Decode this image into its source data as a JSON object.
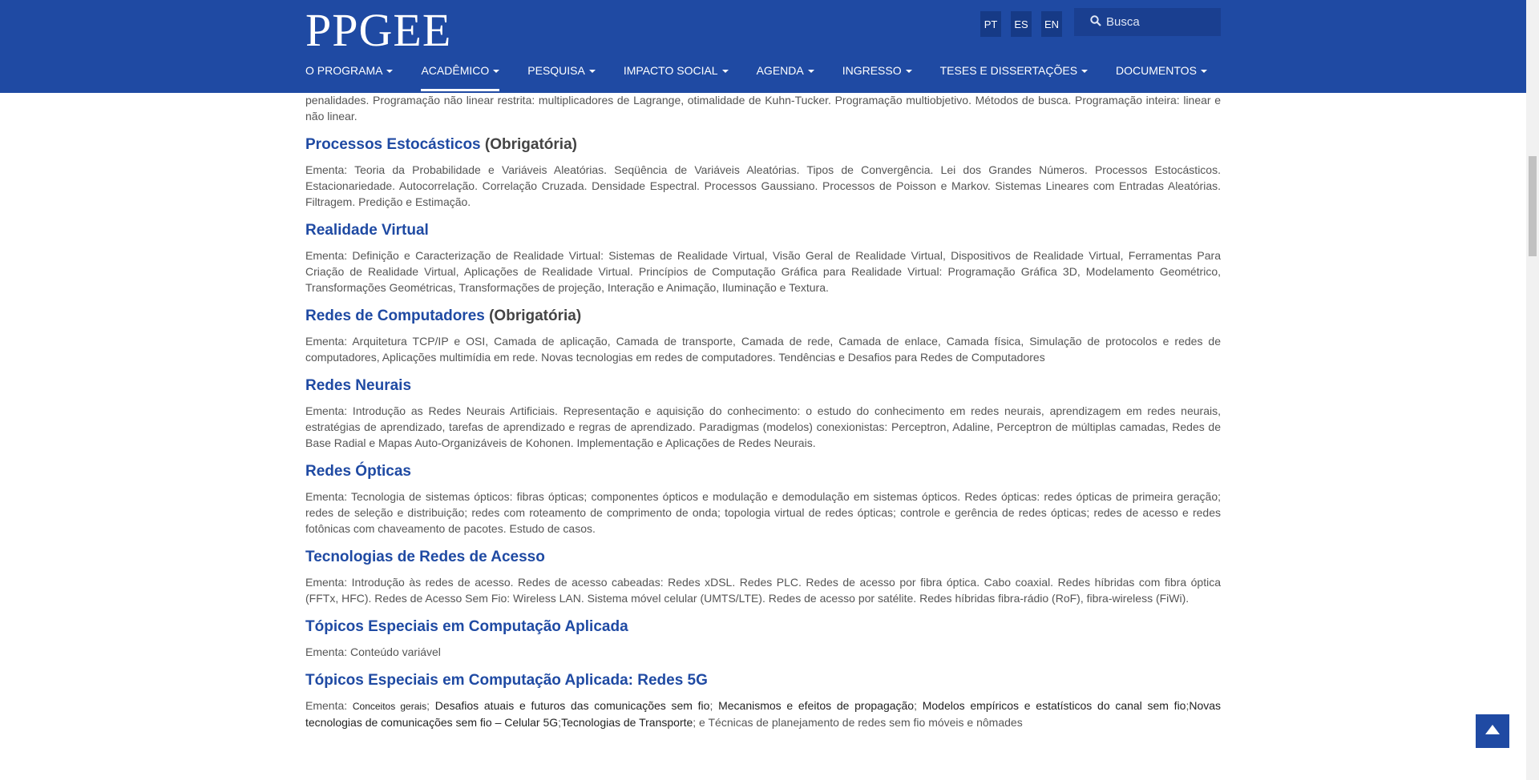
{
  "header": {
    "logo": "PPGEE",
    "languages": [
      "PT",
      "ES",
      "EN"
    ],
    "search_placeholder": "Busca",
    "nav": [
      {
        "label": "O PROGRAMA",
        "active": false
      },
      {
        "label": "ACADÊMICO",
        "active": true
      },
      {
        "label": "PESQUISA",
        "active": false
      },
      {
        "label": "IMPACTO SOCIAL",
        "active": false
      },
      {
        "label": "AGENDA",
        "active": false
      },
      {
        "label": "INGRESSO",
        "active": false
      },
      {
        "label": "TESES E DISSERTAÇÕES",
        "active": false
      },
      {
        "label": "DOCUMENTOS",
        "active": false
      }
    ]
  },
  "intro_text": "penalidades. Programação não linear restrita: multiplicadores de Lagrange, otimalidade de Kuhn-Tucker. Programação multiobjetivo. Métodos de busca. Programação inteira: linear e não linear.",
  "courses": [
    {
      "title": "Processos Estocásticos",
      "tag": " (Obrigatória)",
      "desc": "Ementa: Teoria da Probabilidade e Variáveis Aleatórias. Seqüência de Variáveis Aleatórias. Tipos de Convergência. Lei dos Grandes Números. Processos Estocásticos. Estacionariedade. Autocorrelação. Correlação Cruzada. Densidade Espectral. Processos Gaussiano. Processos de Poisson e Markov. Sistemas Lineares com Entradas Aleatórias. Filtragem. Predição e Estimação."
    },
    {
      "title": "Realidade Virtual",
      "tag": "",
      "desc": "Ementa: Definição e Caracterização de Realidade Virtual: Sistemas de Realidade Virtual, Visão Geral de Realidade Virtual, Dispositivos de Realidade Virtual, Ferramentas Para Criação de Realidade Virtual, Aplicações de Realidade Virtual. Princípios de Computação Gráfica para Realidade Virtual: Programação Gráfica 3D, Modelamento Geométrico, Transformações Geométricas, Transformações de projeção, Interação e Animação, Iluminação e Textura."
    },
    {
      "title": "Redes de Computadores",
      "tag": " (Obrigatória)",
      "desc": "Ementa: Arquitetura TCP/IP e OSI, Camada de aplicação, Camada de transporte, Camada de rede, Camada de enlace, Camada física, Simulação de protocolos e redes de computadores, Aplicações multimídia em rede. Novas tecnologias em redes de computadores. Tendências e Desafios para Redes de Computadores"
    },
    {
      "title": "Redes Neurais",
      "tag": "",
      "desc": "Ementa: Introdução as Redes Neurais Artificiais. Representação e aquisição do conhecimento: o estudo do conhecimento em redes neurais, aprendizagem em redes neurais, estratégias de aprendizado, tarefas de aprendizado e regras de aprendizado. Paradigmas (modelos) conexionistas: Perceptron, Adaline, Perceptron de múltiplas camadas, Redes de Base Radial e Mapas Auto-Organizáveis de Kohonen. Implementação e Aplicações de Redes Neurais."
    },
    {
      "title": "Redes Ópticas",
      "tag": "",
      "desc": "Ementa: Tecnologia de sistemas ópticos: fibras ópticas; componentes ópticos e modulação e demodulação em sistemas ópticos. Redes ópticas: redes ópticas de primeira geração; redes de seleção e distribuição; redes com roteamento de comprimento de onda; topologia virtual de redes ópticas; controle e gerência de redes ópticas; redes de acesso e redes fotônicas com chaveamento de pacotes. Estudo de casos."
    },
    {
      "title": "Tecnologias de Redes de Acesso",
      "tag": "",
      "desc": "Ementa: Introdução às redes de acesso. Redes de acesso cabeadas: Redes xDSL. Redes PLC. Redes de acesso por fibra óptica. Cabo coaxial. Redes híbridas com fibra óptica (FFTx, HFC). Redes de Acesso Sem Fio: Wireless LAN. Sistema móvel celular (UMTS/LTE). Redes de acesso por satélite. Redes híbridas fibra-rádio (RoF), fibra-wireless (FiWi)."
    },
    {
      "title": "Tópicos Especiais em Computação Aplicada",
      "tag": "",
      "desc": "Ementa: Conteúdo variável"
    }
  ],
  "last_course": {
    "title": "Tópicos Especiais em Computação Aplicada: Redes 5G",
    "prefix": "Ementa: ",
    "part1": "Conceitos gerais",
    "part2": "; ",
    "part3": "Desafios atuais e futuros das comunicações sem fio",
    "part4": "; ",
    "part5": "Mecanismos e efeitos de propagação",
    "part6": "; ",
    "part7": "Modelos empíricos e estatísticos do canal sem fio",
    "part8": ";",
    "part9": "Novas tecnologias de comunicações sem fio – Celular 5G",
    "part10": ";",
    "part11": "Tecnologias de Transporte",
    "part12": "; e ",
    "part13": "Técnicas de planejamento de redes sem fio móveis e nômades"
  }
}
